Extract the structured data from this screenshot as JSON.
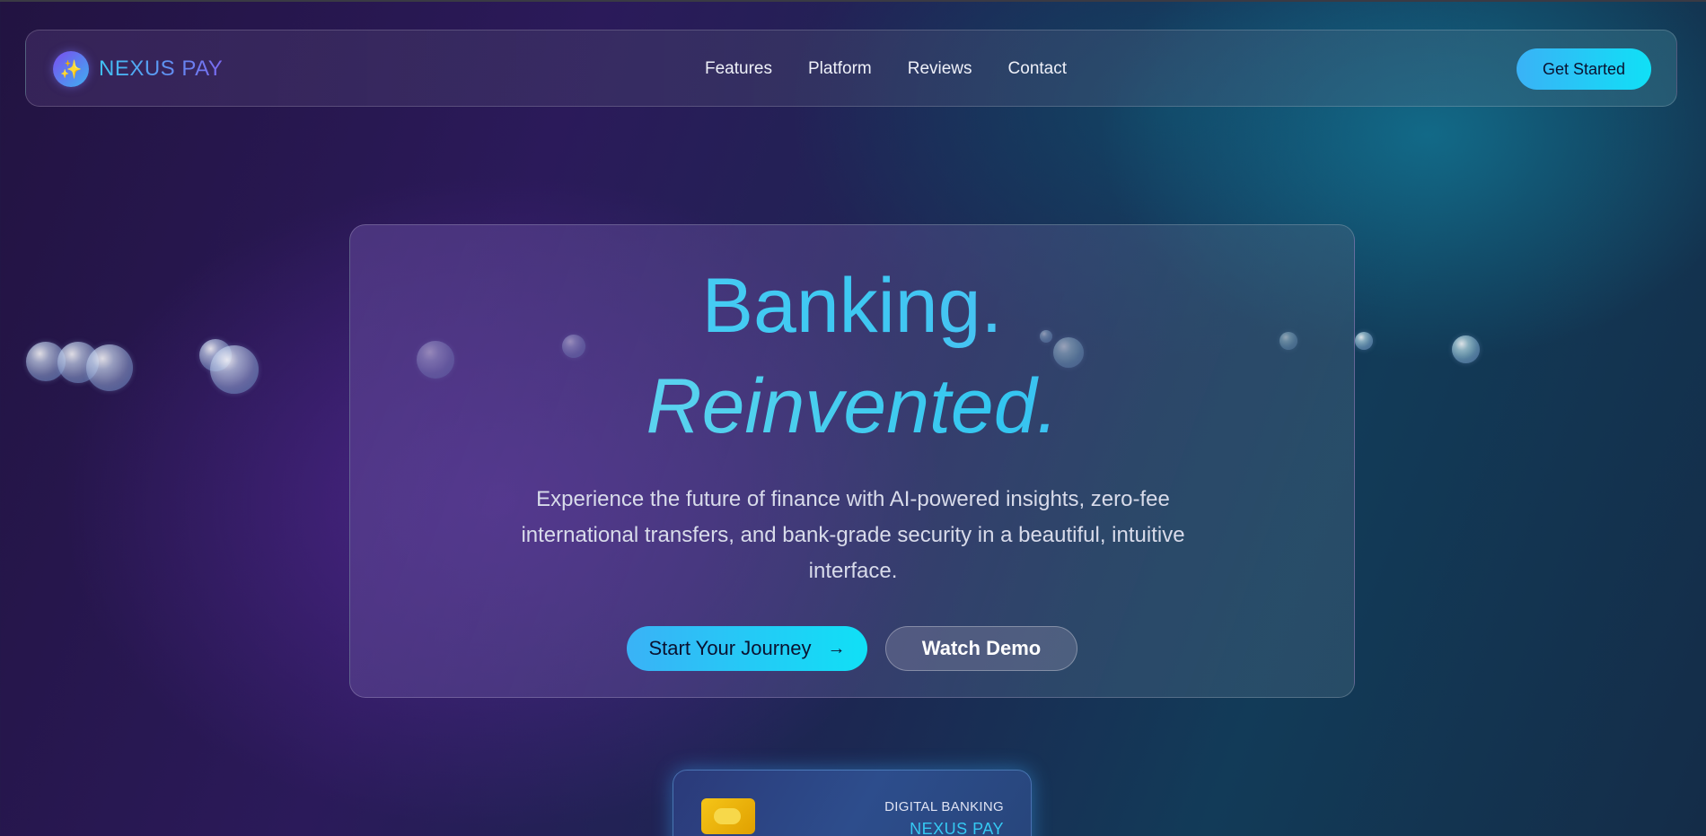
{
  "header": {
    "brand_name": "NEXUS PAY",
    "logo_icon": "sparkle-icon",
    "nav": [
      "Features",
      "Platform",
      "Reviews",
      "Contact"
    ],
    "cta_label": "Get Started"
  },
  "hero": {
    "title_line1": "Banking.",
    "title_line2": "Reinvented.",
    "description": "Experience the future of finance with AI-powered insights, zero-fee international transfers, and bank-grade security in a beautiful, intuitive interface.",
    "primary_button": "Start Your Journey",
    "primary_button_icon": "arrow-right-icon",
    "secondary_button": "Watch Demo"
  },
  "card": {
    "label": "DIGITAL BANKING",
    "brand": "NEXUS PAY"
  },
  "colors": {
    "accent_gradient_start": "#3ab2f6",
    "accent_gradient_end": "#10e0f6",
    "brand_text_start": "#3fc3f3",
    "brand_text_end": "#7a68f0",
    "background_dark": "#221341",
    "card_chip": "#f5c518"
  }
}
